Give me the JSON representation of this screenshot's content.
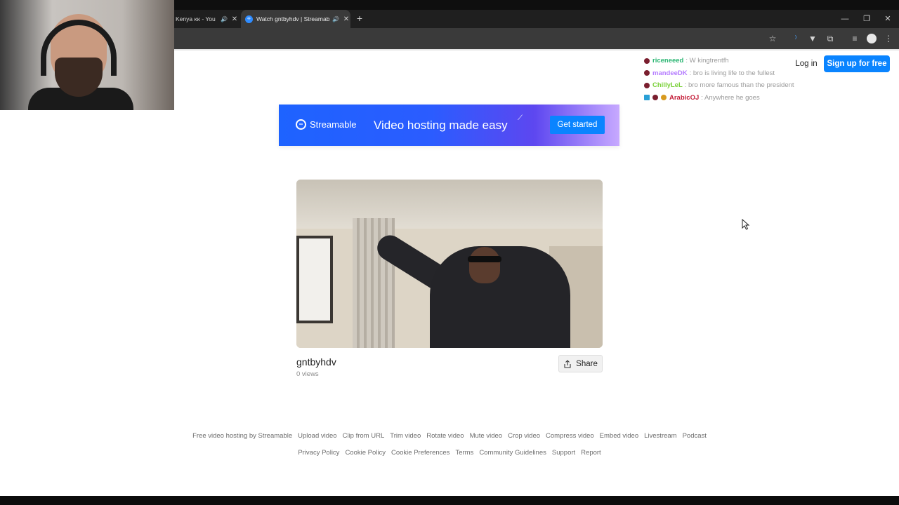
{
  "browser": {
    "tabs": [
      {
        "title": "Kenya ᴋᴋ - You",
        "active": false
      },
      {
        "title": "Watch gntbyhdv | Streamab",
        "active": true
      }
    ],
    "new_tab_symbol": "+",
    "window_controls": [
      "minimize-icon",
      "restore-icon",
      "close-icon"
    ]
  },
  "chat": [
    {
      "user": "riceneeed",
      "user_color": "#2bb673",
      "message": ": W kingtrentfh"
    },
    {
      "user": "mandeeDK",
      "user_color": "#b57cff",
      "message": ": bro is living life to the fullest"
    },
    {
      "user": "ChillyLeL",
      "user_color": "#7bd13a",
      "message": ": bro more famous than the president"
    },
    {
      "user": "ArabicOJ",
      "user_color": "#c41f3a",
      "message": ": Anywhere he goes"
    }
  ],
  "header": {
    "login_label": "Log in",
    "signup_label": "Sign up for free"
  },
  "banner": {
    "brand": "Streamable",
    "tagline": "Video hosting made easy",
    "cta_label": "Get started"
  },
  "video": {
    "title": "gntbyhdv",
    "views": "0 views",
    "share_label": "Share"
  },
  "footer": {
    "row1": [
      "Free video hosting by Streamable",
      "Upload video",
      "Clip from URL",
      "Trim video",
      "Rotate video",
      "Mute video",
      "Crop video",
      "Compress video",
      "Embed video",
      "Livestream",
      "Podcast"
    ],
    "row2": [
      "Privacy Policy",
      "Cookie Policy",
      "Cookie Preferences",
      "Terms",
      "Community Guidelines",
      "Support",
      "Report"
    ]
  },
  "colors": {
    "accent": "#0a84ff",
    "chrome_dark": "#1f1f1f",
    "chrome_toolbar": "#3a3a3a"
  }
}
